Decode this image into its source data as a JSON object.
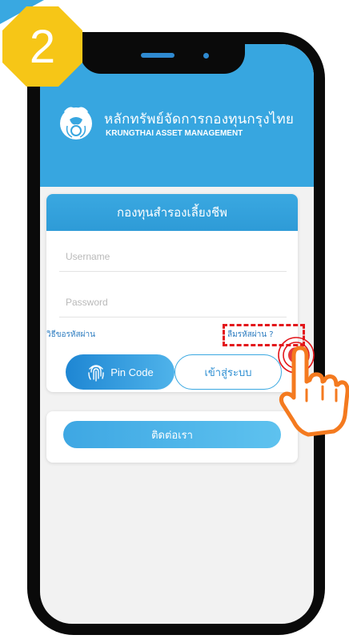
{
  "step": {
    "number": "2"
  },
  "colors": {
    "brand_blue": "#37a6e0",
    "badge_yellow": "#f6c617",
    "highlight_red": "#e3161b",
    "hand_orange": "#f47a1f"
  },
  "brand": {
    "name_th": "หลักทรัพย์จัดการกองทุนกรุงไทย",
    "name_en": "KRUNGTHAI ASSET MANAGEMENT"
  },
  "login_card": {
    "title": "กองทุนสำรองเลี้ยงชีพ",
    "username_placeholder": "Username",
    "password_placeholder": "Password",
    "request_password_link": "วิธีขอรหัสผ่าน",
    "forgot_password_link": "ลืมรหัสผ่าน ?",
    "pin_button": "Pin Code",
    "login_button": "เข้าสู่ระบบ"
  },
  "contact": {
    "button": "ติดต่อเรา"
  },
  "icons": {
    "logo": "garuda-logo-icon",
    "fingerprint": "fingerprint-icon",
    "pointer": "hand-pointer-icon"
  }
}
